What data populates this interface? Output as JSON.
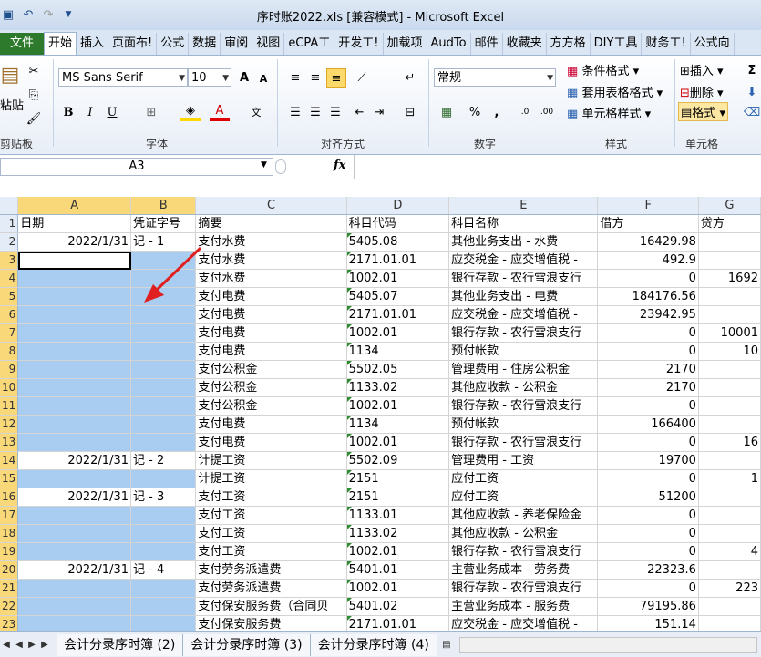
{
  "window": {
    "title": "序时账2022.xls  [兼容模式] - Microsoft Excel"
  },
  "ribbon_tabs": [
    "文件",
    "开始",
    "插入",
    "页面布!",
    "公式",
    "数据",
    "审阅",
    "视图",
    "eCPA工",
    "开发工!",
    "加载项",
    "AudTo",
    "邮件",
    "收藏夹",
    "方方格",
    "DIY工具",
    "财务工!",
    "公式向"
  ],
  "active_tab": "开始",
  "ribbon": {
    "clipboard": {
      "paste": "粘贴",
      "label": "剪贴板"
    },
    "font": {
      "name": "MS Sans Serif",
      "size": "10",
      "label": "字体",
      "bold": "B",
      "italic": "I",
      "underline": "U"
    },
    "alignment": {
      "label": "对齐方式"
    },
    "number": {
      "format": "常规",
      "percent": "%",
      "comma": ",",
      "label": "数字"
    },
    "styles": {
      "conditional": "条件格式",
      "table": "套用表格格式",
      "cell": "单元格样式",
      "label": "样式"
    },
    "cells": {
      "insert": "插入",
      "delete": "删除",
      "format": "格式",
      "label": "单元格"
    }
  },
  "formula_bar": {
    "name_box": "A3",
    "fx": "fx",
    "value": ""
  },
  "columns": [
    "A",
    "B",
    "C",
    "D",
    "E",
    "F",
    "G"
  ],
  "header_row": {
    "row": "1",
    "cells": [
      "日期",
      "凭证字号",
      "摘要",
      "科目代码",
      "科目名称",
      "借方",
      "贷方"
    ]
  },
  "rows": [
    {
      "n": "2",
      "a": "2022/1/31",
      "b": "记 - 1",
      "c": "支付水费",
      "d": "5405.08",
      "e": "其他业务支出 - 水费",
      "f": "16429.98",
      "g": ""
    },
    {
      "n": "3",
      "a": "",
      "b": "",
      "c": "支付水费",
      "d": "2171.01.01",
      "e": "应交税金 - 应交增值税 -",
      "f": "492.9",
      "g": ""
    },
    {
      "n": "4",
      "a": "",
      "b": "",
      "c": "支付水费",
      "d": "1002.01",
      "e": "银行存款 - 农行雪浪支行",
      "f": "0",
      "g": "1692"
    },
    {
      "n": "5",
      "a": "",
      "b": "",
      "c": "支付电费",
      "d": "5405.07",
      "e": "其他业务支出 - 电费",
      "f": "184176.56",
      "g": ""
    },
    {
      "n": "6",
      "a": "",
      "b": "",
      "c": "支付电费",
      "d": "2171.01.01",
      "e": "应交税金 - 应交增值税 -",
      "f": "23942.95",
      "g": ""
    },
    {
      "n": "7",
      "a": "",
      "b": "",
      "c": "支付电费",
      "d": "1002.01",
      "e": "银行存款 - 农行雪浪支行",
      "f": "0",
      "g": "10001"
    },
    {
      "n": "8",
      "a": "",
      "b": "",
      "c": "支付电费",
      "d": "1134",
      "e": "预付帐款",
      "f": "0",
      "g": "10"
    },
    {
      "n": "9",
      "a": "",
      "b": "",
      "c": "支付公积金",
      "d": "5502.05",
      "e": "管理费用 - 住房公积金",
      "f": "2170",
      "g": ""
    },
    {
      "n": "10",
      "a": "",
      "b": "",
      "c": "支付公积金",
      "d": "1133.02",
      "e": "其他应收款 - 公积金",
      "f": "2170",
      "g": ""
    },
    {
      "n": "11",
      "a": "",
      "b": "",
      "c": "支付公积金",
      "d": "1002.01",
      "e": "银行存款 - 农行雪浪支行",
      "f": "0",
      "g": ""
    },
    {
      "n": "12",
      "a": "",
      "b": "",
      "c": "支付电费",
      "d": "1134",
      "e": "预付帐款",
      "f": "166400",
      "g": ""
    },
    {
      "n": "13",
      "a": "",
      "b": "",
      "c": "支付电费",
      "d": "1002.01",
      "e": "银行存款 - 农行雪浪支行",
      "f": "0",
      "g": "16"
    },
    {
      "n": "14",
      "a": "2022/1/31",
      "b": "记 - 2",
      "c": "计提工资",
      "d": "5502.09",
      "e": "管理费用 - 工资",
      "f": "19700",
      "g": ""
    },
    {
      "n": "15",
      "a": "",
      "b": "",
      "c": "计提工资",
      "d": "2151",
      "e": "应付工资",
      "f": "0",
      "g": "1"
    },
    {
      "n": "16",
      "a": "2022/1/31",
      "b": "记 - 3",
      "c": "支付工资",
      "d": "2151",
      "e": "应付工资",
      "f": "51200",
      "g": ""
    },
    {
      "n": "17",
      "a": "",
      "b": "",
      "c": "支付工资",
      "d": "1133.01",
      "e": "其他应收款 - 养老保险金",
      "f": "0",
      "g": ""
    },
    {
      "n": "18",
      "a": "",
      "b": "",
      "c": "支付工资",
      "d": "1133.02",
      "e": "其他应收款 - 公积金",
      "f": "0",
      "g": ""
    },
    {
      "n": "19",
      "a": "",
      "b": "",
      "c": "支付工资",
      "d": "1002.01",
      "e": "银行存款 - 农行雪浪支行",
      "f": "0",
      "g": "4"
    },
    {
      "n": "20",
      "a": "2022/1/31",
      "b": "记 - 4",
      "c": "支付劳务派遣费",
      "d": "5401.01",
      "e": "主营业务成本 - 劳务费",
      "f": "22323.6",
      "g": ""
    },
    {
      "n": "21",
      "a": "",
      "b": "",
      "c": "支付劳务派遣费",
      "d": "1002.01",
      "e": "银行存款 - 农行雪浪支行",
      "f": "0",
      "g": "223"
    },
    {
      "n": "22",
      "a": "",
      "b": "",
      "c": "支付保安服务费（合同贝",
      "d": "5401.02",
      "e": "主营业务成本 - 服务费",
      "f": "79195.86",
      "g": ""
    },
    {
      "n": "23",
      "a": "",
      "b": "",
      "c": "支付保安服务费",
      "d": "2171.01.01",
      "e": "应交税金 - 应交增值税 -",
      "f": "151.14",
      "g": ""
    }
  ],
  "sheet_tabs": [
    "会计分录序时簿 (2)",
    "会计分录序时簿 (3)",
    "会计分录序时簿 (4)"
  ]
}
